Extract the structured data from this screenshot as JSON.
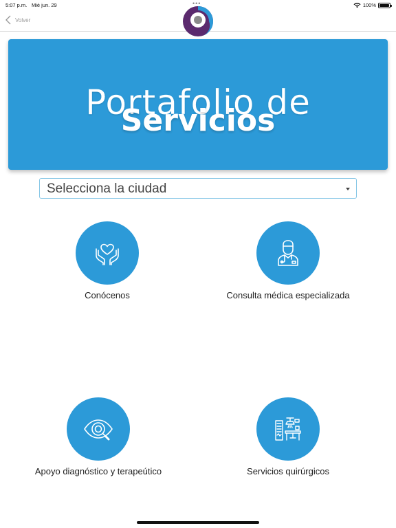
{
  "status_bar": {
    "time": "5:07 p.m.",
    "date": "Mié jun. 29",
    "dots": "•••",
    "battery": "100%"
  },
  "nav": {
    "back_label": "Volver"
  },
  "banner": {
    "line1": "Portafolio de",
    "line2": "Servicios",
    "background": "#2c9ad8"
  },
  "city_select": {
    "selected": "Selecciona la ciudad"
  },
  "services": [
    {
      "label": "Conócenos",
      "icon": "hands-heart-icon"
    },
    {
      "label": "Consulta médica especializada",
      "icon": "doctor-icon"
    },
    {
      "label": "Apoyo diagnóstico y terapeútico",
      "icon": "eye-magnifier-icon"
    },
    {
      "label": "Servicios quirúrgicos",
      "icon": "operating-room-icon"
    }
  ],
  "colors": {
    "accent": "#2c9ad8",
    "logo_purple": "#5b2a6e",
    "logo_blue": "#2c9ad8"
  }
}
